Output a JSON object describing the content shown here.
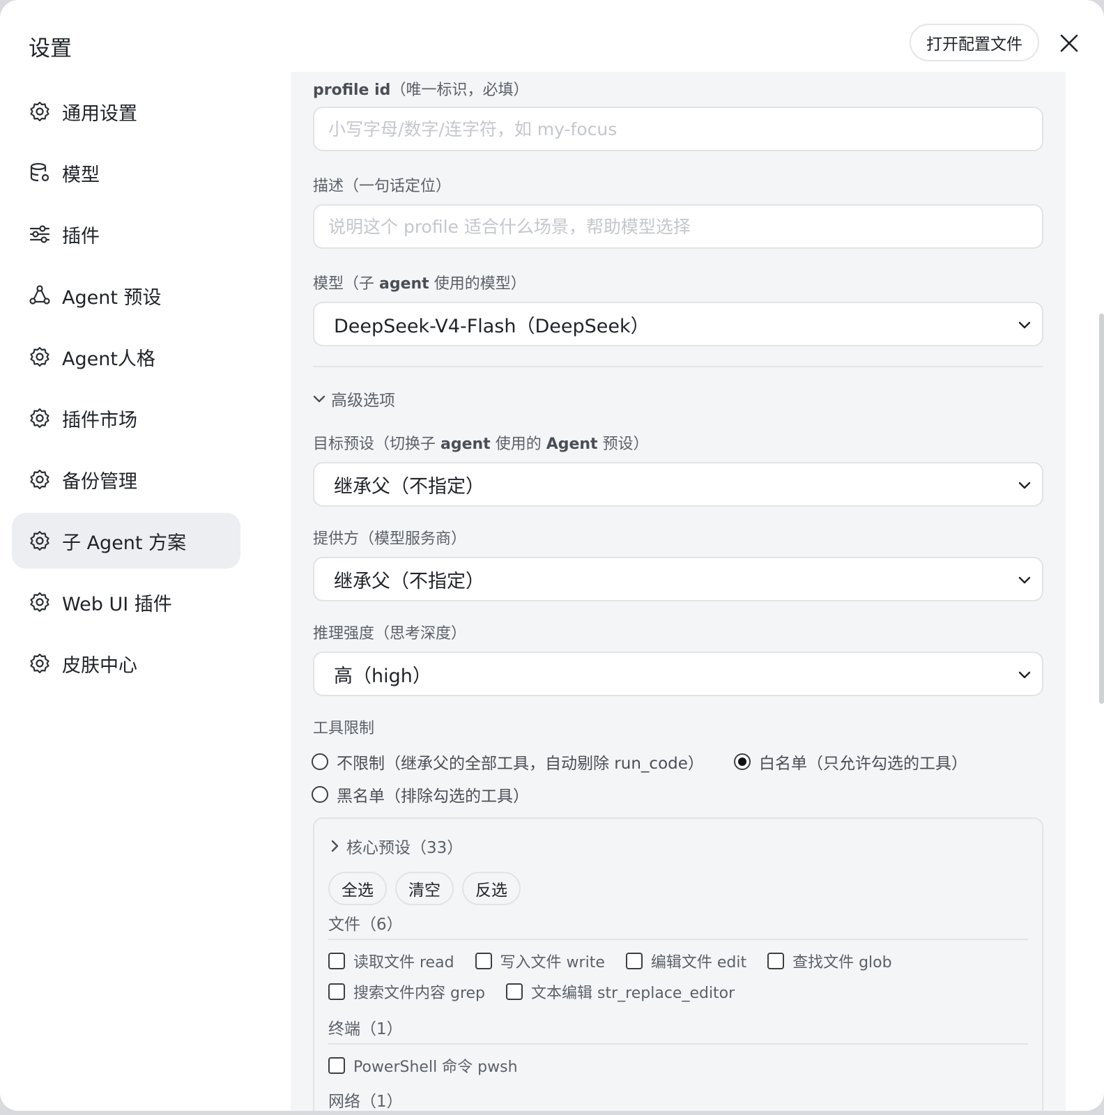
{
  "header": {
    "title": "设置",
    "open_config_label": "打开配置文件"
  },
  "sidebar": {
    "items": [
      {
        "label": "通用设置",
        "icon": "gear-icon"
      },
      {
        "label": "模型",
        "icon": "database-gear-icon"
      },
      {
        "label": "插件",
        "icon": "sliders-icon"
      },
      {
        "label": "Agent 预设",
        "icon": "triangle-nodes-icon"
      },
      {
        "label": "Agent人格",
        "icon": "gear-icon"
      },
      {
        "label": "插件市场",
        "icon": "gear-icon"
      },
      {
        "label": "备份管理",
        "icon": "gear-icon"
      },
      {
        "label": "子 Agent 方案",
        "icon": "gear-icon",
        "active": true
      },
      {
        "label": "Web UI 插件",
        "icon": "gear-icon"
      },
      {
        "label": "皮肤中心",
        "icon": "gear-icon"
      }
    ]
  },
  "form": {
    "profile_id": {
      "label_main": "profile id",
      "label_hint": "（唯一标识，必填）",
      "value": "",
      "placeholder": "小写字母/数字/连字符，如 my-focus"
    },
    "description": {
      "label": "描述（一句话定位）",
      "value": "",
      "placeholder": "说明这个 profile 适合什么场景，帮助模型选择"
    },
    "model": {
      "label_a": "模型（子 ",
      "label_b": "agent",
      "label_c": " 使用的模型）",
      "selected": "DeepSeek-V4-Flash（DeepSeek）"
    },
    "advanced_label": "高级选项",
    "target_preset": {
      "label_a": "目标预设（切换子 ",
      "label_b": "agent",
      "label_c": " 使用的 ",
      "label_d": "Agent",
      "label_e": " 预设）",
      "selected": "继承父（不指定）"
    },
    "provider": {
      "label": "提供方（模型服务商）",
      "selected": "继承父（不指定）"
    },
    "reasoning": {
      "label": "推理强度（思考深度）",
      "selected": "高（high）"
    },
    "tool_limit": {
      "label": "工具限制",
      "options": [
        {
          "label": "不限制（继承父的全部工具，自动剔除 run_code）",
          "checked": false
        },
        {
          "label": "白名单（只允许勾选的工具）",
          "checked": true
        },
        {
          "label": "黑名单（排除勾选的工具）",
          "checked": false
        }
      ]
    },
    "tools": {
      "core_label": "核心预设（33）",
      "buttons": [
        "全选",
        "清空",
        "反选"
      ],
      "groups": [
        {
          "title": "文件（6）",
          "items": [
            "读取文件 read",
            "写入文件 write",
            "编辑文件 edit",
            "查找文件 glob",
            "搜索文件内容 grep",
            "文本编辑 str_replace_editor"
          ]
        },
        {
          "title": "终端（1）",
          "items": [
            "PowerShell 命令 pwsh"
          ]
        },
        {
          "title": "网络（1）",
          "items": []
        }
      ]
    }
  }
}
